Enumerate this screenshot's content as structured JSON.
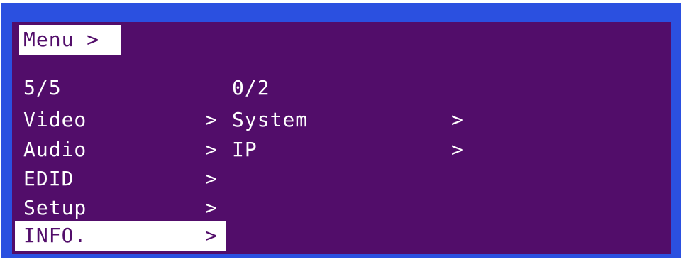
{
  "colors": {
    "border": "#2b50e0",
    "background": "#520d6a",
    "text": "#ffffff",
    "highlight_bg": "#ffffff",
    "highlight_text": "#520d6a"
  },
  "menu": {
    "title": "Menu >",
    "left_counter": "5/5",
    "right_counter": "0/2",
    "left_items": [
      {
        "label": "Video",
        "arrow": ">"
      },
      {
        "label": "Audio",
        "arrow": ">"
      },
      {
        "label": "EDID",
        "arrow": ">"
      },
      {
        "label": "Setup",
        "arrow": ">"
      },
      {
        "label": "INFO.",
        "arrow": ">"
      }
    ],
    "right_items": [
      {
        "label": "System",
        "arrow": ">"
      },
      {
        "label": "IP",
        "arrow": ">"
      }
    ]
  }
}
